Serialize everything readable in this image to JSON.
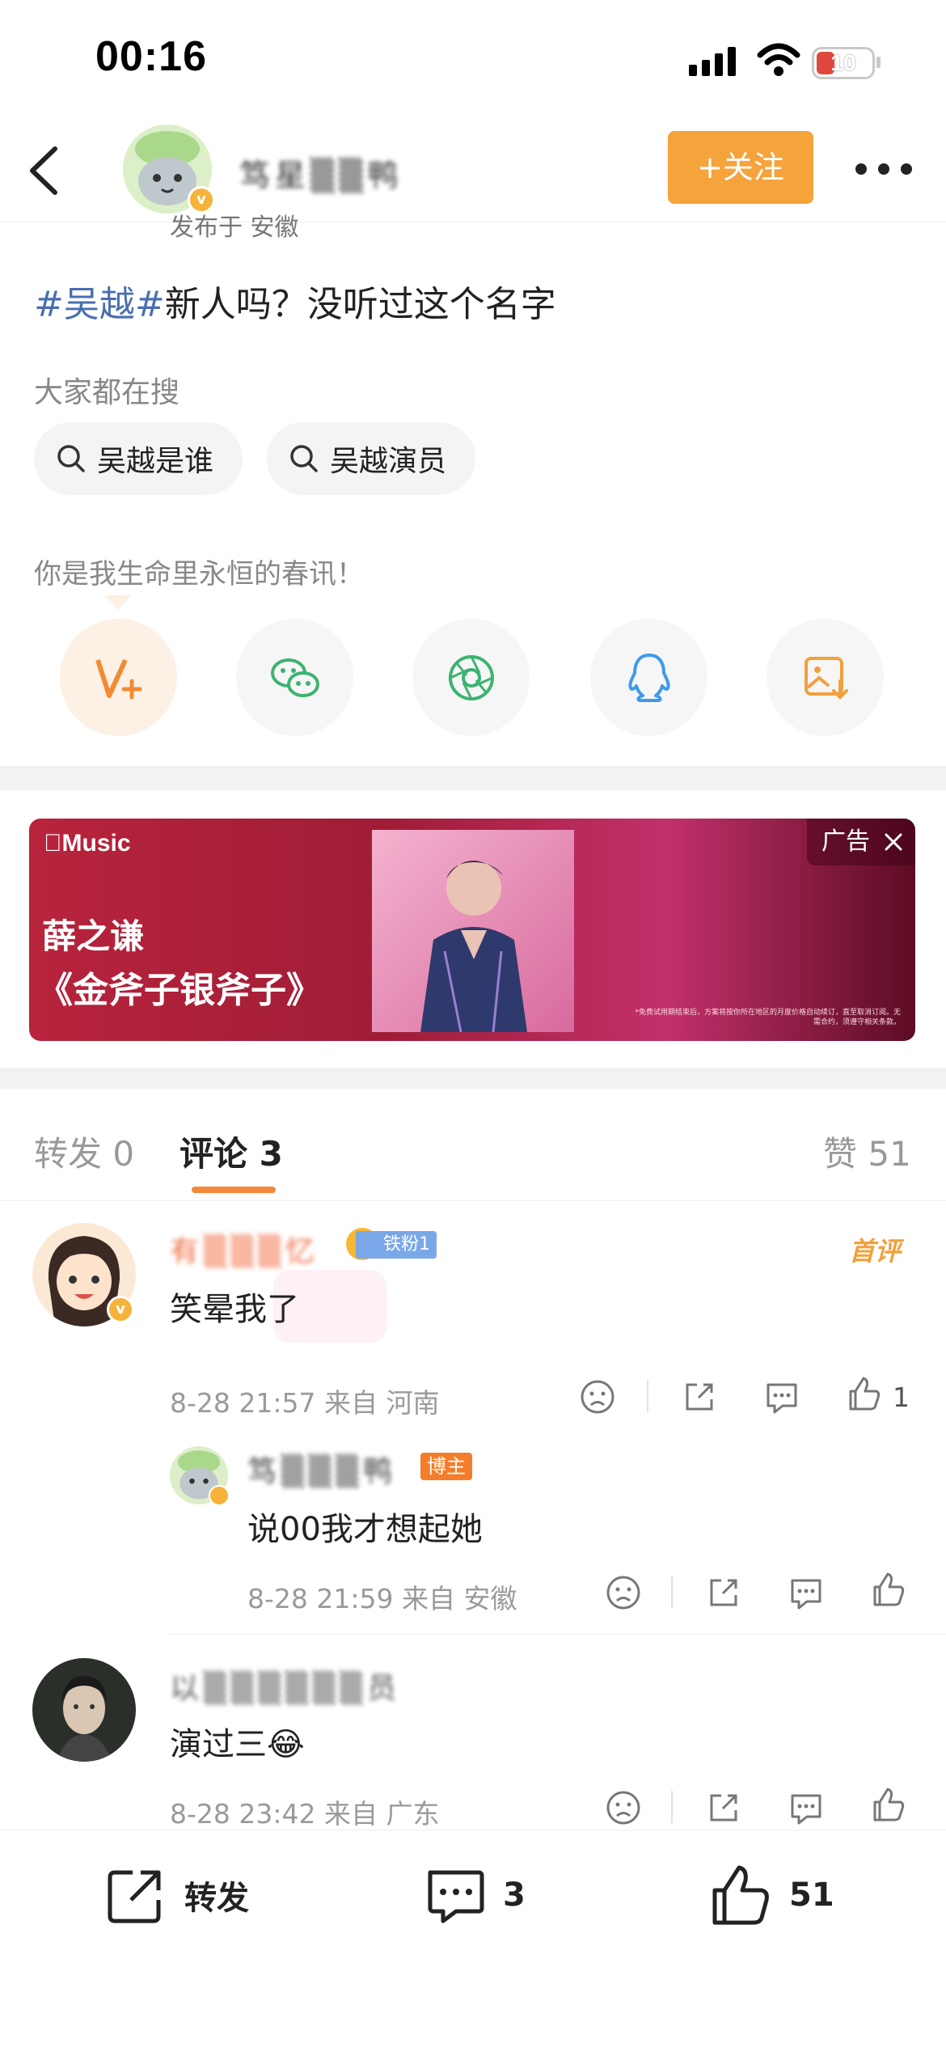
{
  "status_bar": {
    "time": "00:16",
    "battery": "10"
  },
  "header": {
    "username": "笃星▒▒鸭",
    "follow_label": "+关注"
  },
  "post": {
    "published": "发布于 安徽",
    "hashtag": "#吴越#",
    "text": "新人吗？没听过这个名字"
  },
  "search": {
    "label": "大家都在搜",
    "chips": [
      "吴越是谁",
      "吴越演员"
    ]
  },
  "slogan": "你是我生命里永恒的春讯！",
  "share_icons": [
    "weibo-icon",
    "wechat-icon",
    "moments-icon",
    "qq-icon",
    "save-image-icon"
  ],
  "ad": {
    "brand": "Music",
    "artist": "薛之谦",
    "song": "《金斧子银斧子》",
    "badge": "广告",
    "disclaimer": "*免费试用期结束后，方案将按你所在地区的月度价格自动续订，直至取消订阅。无需合约，须遵守相关条款。"
  },
  "tabs": {
    "repost": "转发 0",
    "comment": "评论 3",
    "likes": "赞 51"
  },
  "comments": [
    {
      "name": "有▒▒▒忆",
      "fan_badge": "铁粉1",
      "first_badge": "首评",
      "text": "笑晕我了",
      "time": "8-28 21:57 来自 河南",
      "like_count": "1",
      "reply": {
        "name": "笃▒▒▒鸭",
        "host_badge": "博主",
        "text": "说00我才想起她",
        "time": "8-28 21:59 来自 安徽"
      }
    },
    {
      "name": "以▒▒▒▒▒▒员",
      "text": "演过三",
      "emoji": "😂",
      "time": "8-28 23:42 来自 广东"
    }
  ],
  "bottom_bar": {
    "repost": "转发",
    "comment_count": "3",
    "like_count": "51"
  },
  "colors": {
    "accent": "#f5a33b",
    "tag": "#4a6eb0",
    "name": "#f07046"
  }
}
